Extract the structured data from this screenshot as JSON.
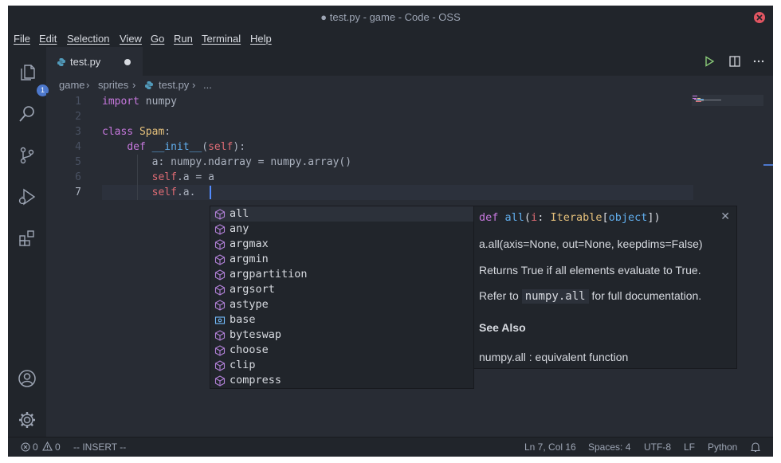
{
  "window": {
    "title": "● test.py - game - Code - OSS"
  },
  "menu": [
    "File",
    "Edit",
    "Selection",
    "View",
    "Go",
    "Run",
    "Terminal",
    "Help"
  ],
  "activity": {
    "explorer_badge": "1"
  },
  "tab": {
    "label": "test.py"
  },
  "breadcrumb": [
    "game",
    "sprites",
    "test.py",
    "..."
  ],
  "code": [
    {
      "n": "1"
    },
    {
      "n": "2"
    },
    {
      "n": "3"
    },
    {
      "n": "4"
    },
    {
      "n": "5"
    },
    {
      "n": "6"
    },
    {
      "n": "7"
    }
  ],
  "suggestions": [
    {
      "label": "all",
      "kind": "method"
    },
    {
      "label": "any",
      "kind": "method"
    },
    {
      "label": "argmax",
      "kind": "method"
    },
    {
      "label": "argmin",
      "kind": "method"
    },
    {
      "label": "argpartition",
      "kind": "method"
    },
    {
      "label": "argsort",
      "kind": "method"
    },
    {
      "label": "astype",
      "kind": "method"
    },
    {
      "label": "base",
      "kind": "field"
    },
    {
      "label": "byteswap",
      "kind": "method"
    },
    {
      "label": "choose",
      "kind": "method"
    },
    {
      "label": "clip",
      "kind": "method"
    },
    {
      "label": "compress",
      "kind": "method"
    }
  ],
  "docs": {
    "sig_def": "def",
    "sig_name": "all",
    "sig_params_open": "(",
    "sig_param": "i",
    "sig_colon": ": ",
    "sig_type": "Iterable",
    "sig_bracket_open": "[",
    "sig_inner": "object",
    "sig_bracket_close": "])",
    "line1": "a.all(axis=None, out=None, keepdims=False)",
    "line2": "Returns True if all elements evaluate to True.",
    "line3_pre": "Refer to",
    "line3_code": "numpy.all",
    "line3_post": "for full documentation.",
    "see_also": "See Also",
    "line4": "numpy.all : equivalent function"
  },
  "status": {
    "errors": "0",
    "warnings": "0",
    "mode": "-- INSERT --",
    "position": "Ln 7, Col 16",
    "spaces": "Spaces: 4",
    "encoding": "UTF-8",
    "eol": "LF",
    "language": "Python"
  },
  "colors": {
    "accent": "#4d78cc",
    "close": "#e05561",
    "cursor": "#528bff"
  }
}
